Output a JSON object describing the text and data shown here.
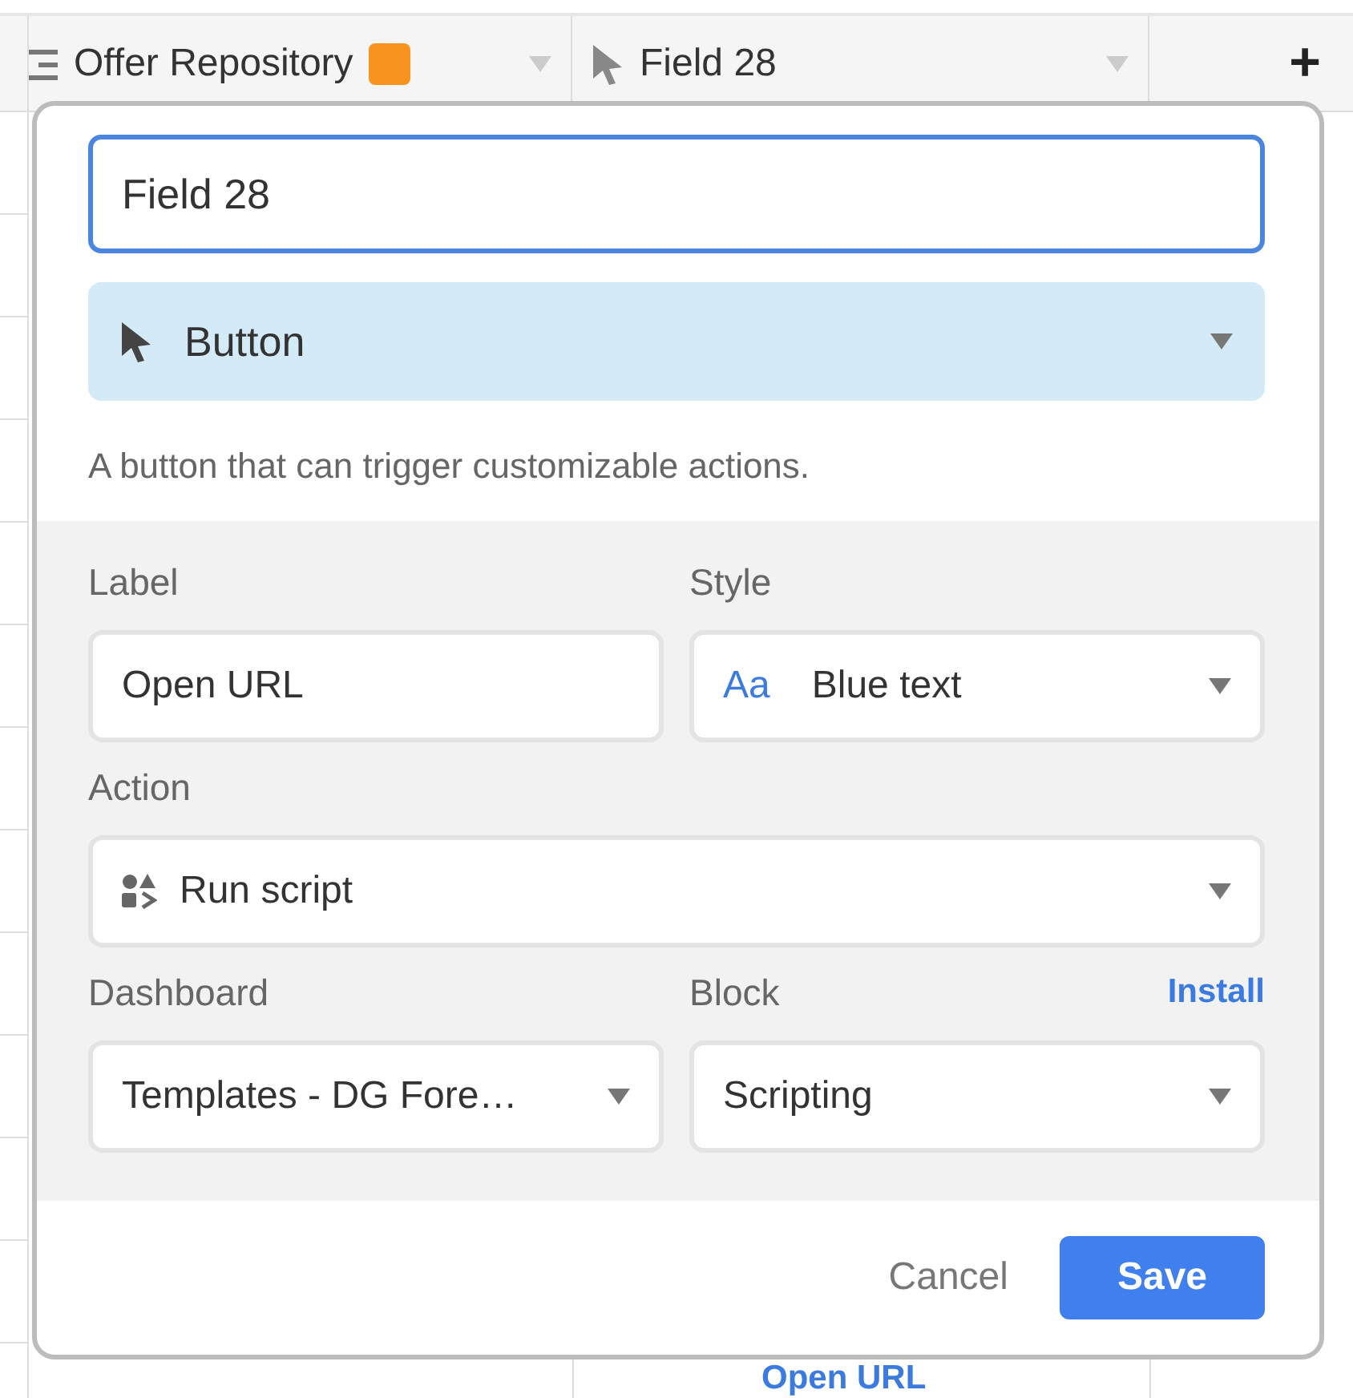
{
  "grid_header": {
    "columns": [
      {
        "label": "Offer Repository",
        "kind": "primary"
      },
      {
        "label": "Field 28",
        "kind": "button"
      }
    ],
    "add_column": "+"
  },
  "dialog": {
    "field_name": {
      "value": "Field 28"
    },
    "field_type": {
      "label": "Button"
    },
    "description": "A button that can trigger customizable actions.",
    "label": {
      "caption": "Label",
      "value": "Open URL"
    },
    "style": {
      "caption": "Style",
      "icon_text": "Aa",
      "value": "Blue text"
    },
    "action": {
      "caption": "Action",
      "value": "Run script"
    },
    "dashboard": {
      "caption": "Dashboard",
      "value": "Templates - DG Fore…"
    },
    "block": {
      "caption": "Block",
      "link": "Install",
      "value": "Scripting"
    },
    "buttons": {
      "cancel": "Cancel",
      "save": "Save"
    }
  },
  "cell_text": "Open URL"
}
